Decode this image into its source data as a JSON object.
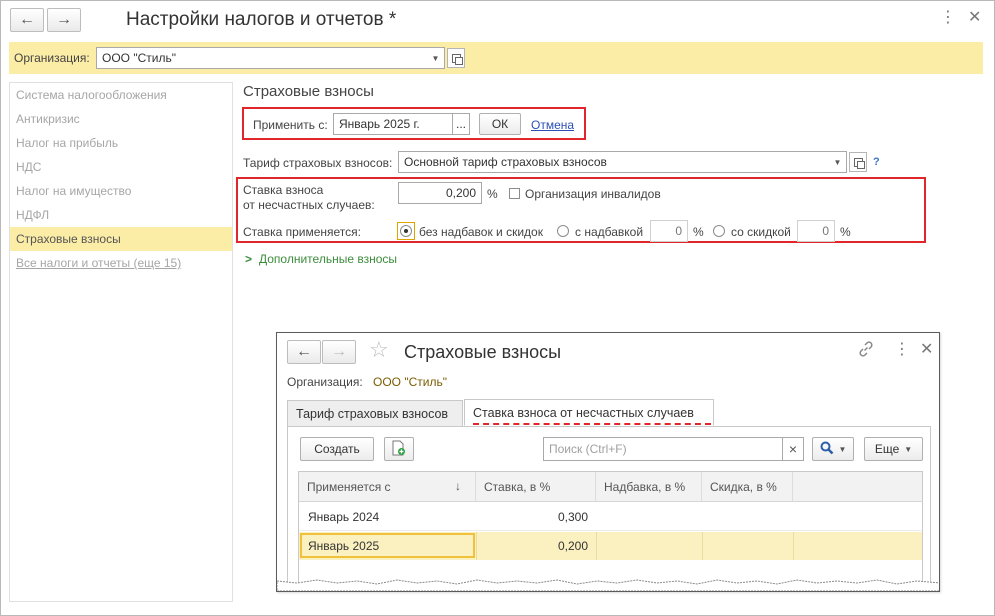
{
  "window": {
    "title": "Настройки налогов и отчетов *",
    "back_icon": "←",
    "forward_icon": "→",
    "menu_icon": "⋮",
    "close_icon": "✕"
  },
  "org_bar": {
    "label": "Организация:",
    "value": "ООО \"Стиль\""
  },
  "sidebar": {
    "items": [
      {
        "label": "Система налогообложения"
      },
      {
        "label": "Антикризис"
      },
      {
        "label": "Налог на прибыль"
      },
      {
        "label": "НДС"
      },
      {
        "label": "Налог на имущество"
      },
      {
        "label": "НДФЛ"
      },
      {
        "label": "Страховые взносы"
      },
      {
        "label": "Все налоги и отчеты (еще 15)"
      }
    ],
    "active_index": 6
  },
  "main": {
    "section_title": "Страховые взносы",
    "apply_from": {
      "label": "Применить с:",
      "value": "Январь 2025 г.",
      "picker": "...",
      "ok": "ОК",
      "cancel": "Отмена"
    },
    "tariff": {
      "label": "Тариф страховых взносов:",
      "value": "Основной тариф страховых взносов",
      "help": "?"
    },
    "accident_rate": {
      "label_line1": "Ставка взноса",
      "label_line2": "от несчастных случаев:",
      "value": "0,200",
      "unit": "%",
      "disabled_org_label": "Организация инвалидов",
      "disabled_org_checked": false
    },
    "rate_applies": {
      "label": "Ставка применяется:",
      "option1": "без надбавок и скидок",
      "option2": "с надбавкой",
      "option2_value": "0",
      "option3": "со скидкой",
      "option3_value": "0",
      "unit": "%",
      "selected": 1
    },
    "additional": {
      "chevron": ">",
      "label": "Дополнительные взносы"
    }
  },
  "subwindow": {
    "title": "Страховые взносы",
    "back_icon": "←",
    "forward_icon": "→",
    "star_icon": "☆",
    "menu_icon": "⋮",
    "close_icon": "✕",
    "org_label": "Организация:",
    "org_value": "ООО \"Стиль\"",
    "tabs": [
      {
        "label": "Тариф страховых взносов"
      },
      {
        "label": "Ставка взноса от несчастных случаев"
      }
    ],
    "active_tab": 1,
    "toolbar": {
      "create": "Создать",
      "search_placeholder": "Поиск (Ctrl+F)",
      "search_clear": "×",
      "more": "Еще"
    },
    "table": {
      "columns": [
        "Применяется с",
        "Ставка, в %",
        "Надбавка, в %",
        "Скидка, в %"
      ],
      "sort_icon": "↓",
      "rows": [
        {
          "date": "Январь 2024",
          "rate": "0,300",
          "markup": "",
          "discount": ""
        },
        {
          "date": "Январь 2025",
          "rate": "0,200",
          "markup": "",
          "discount": ""
        }
      ],
      "selected_row": 1
    }
  },
  "colors": {
    "accent_yellow": "#fbeca6",
    "highlight_red": "#e0252b",
    "link_blue": "#2b4fb6",
    "green": "#3c8c3c"
  }
}
